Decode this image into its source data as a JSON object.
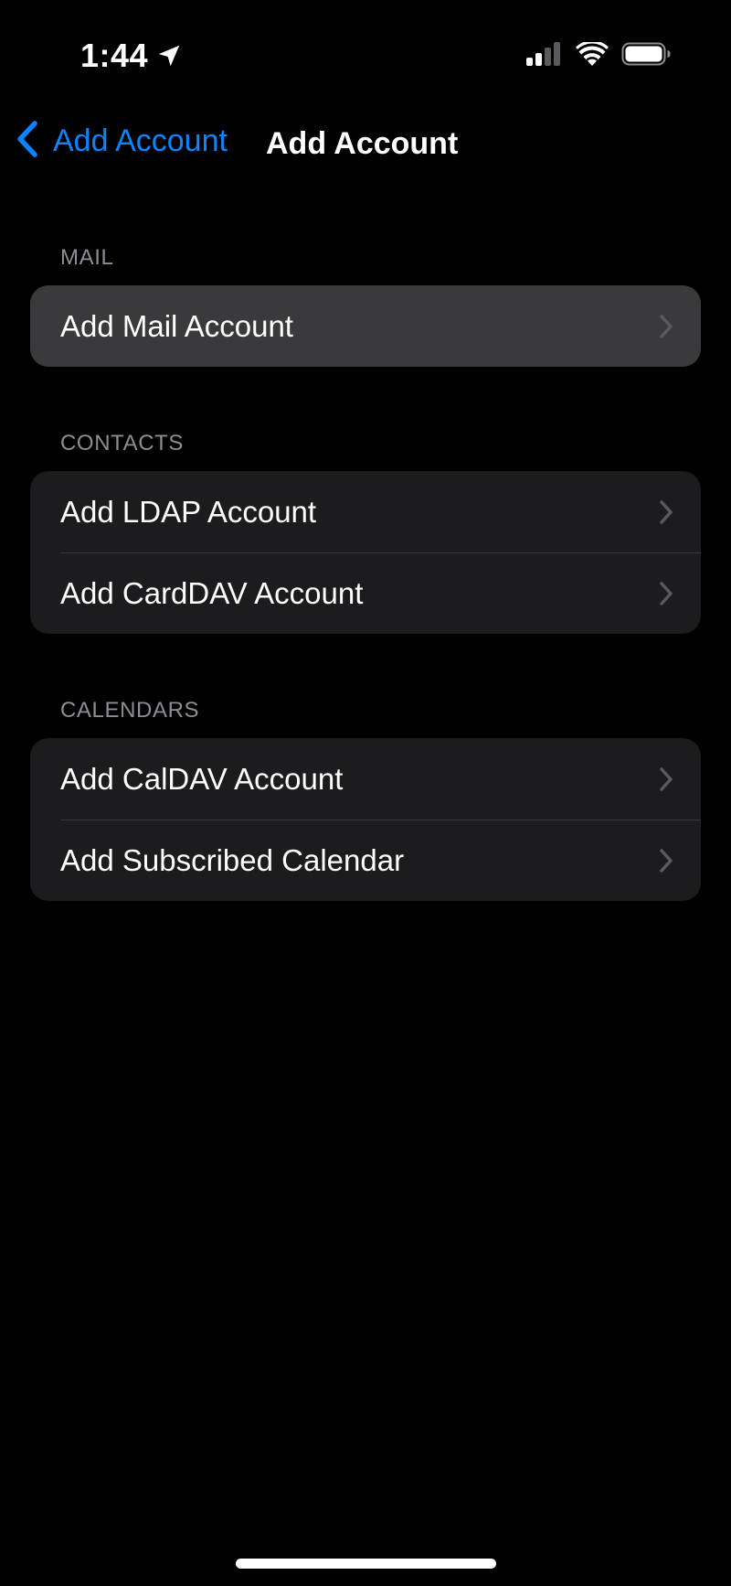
{
  "status_bar": {
    "time": "1:44",
    "location_icon": "location-arrow-icon",
    "signal_icon": "cellular-signal-icon",
    "wifi_icon": "wifi-icon",
    "battery_icon": "battery-icon"
  },
  "nav": {
    "back_label": "Add Account",
    "back_icon": "chevron-left-icon",
    "title": "Add Account"
  },
  "sections": [
    {
      "header": "MAIL",
      "rows": [
        {
          "label": "Add Mail Account",
          "highlighted": true
        }
      ]
    },
    {
      "header": "CONTACTS",
      "rows": [
        {
          "label": "Add LDAP Account"
        },
        {
          "label": "Add CardDAV Account"
        }
      ]
    },
    {
      "header": "CALENDARS",
      "rows": [
        {
          "label": "Add CalDAV Account"
        },
        {
          "label": "Add Subscribed Calendar"
        }
      ]
    }
  ],
  "colors": {
    "background": "#000000",
    "accent": "#0a84ff",
    "group_background": "#1c1c1e",
    "row_highlight": "#3a3a3c",
    "section_header": "#8d8d93",
    "chevron": "#5a5a5e",
    "separator": "#38383a"
  }
}
